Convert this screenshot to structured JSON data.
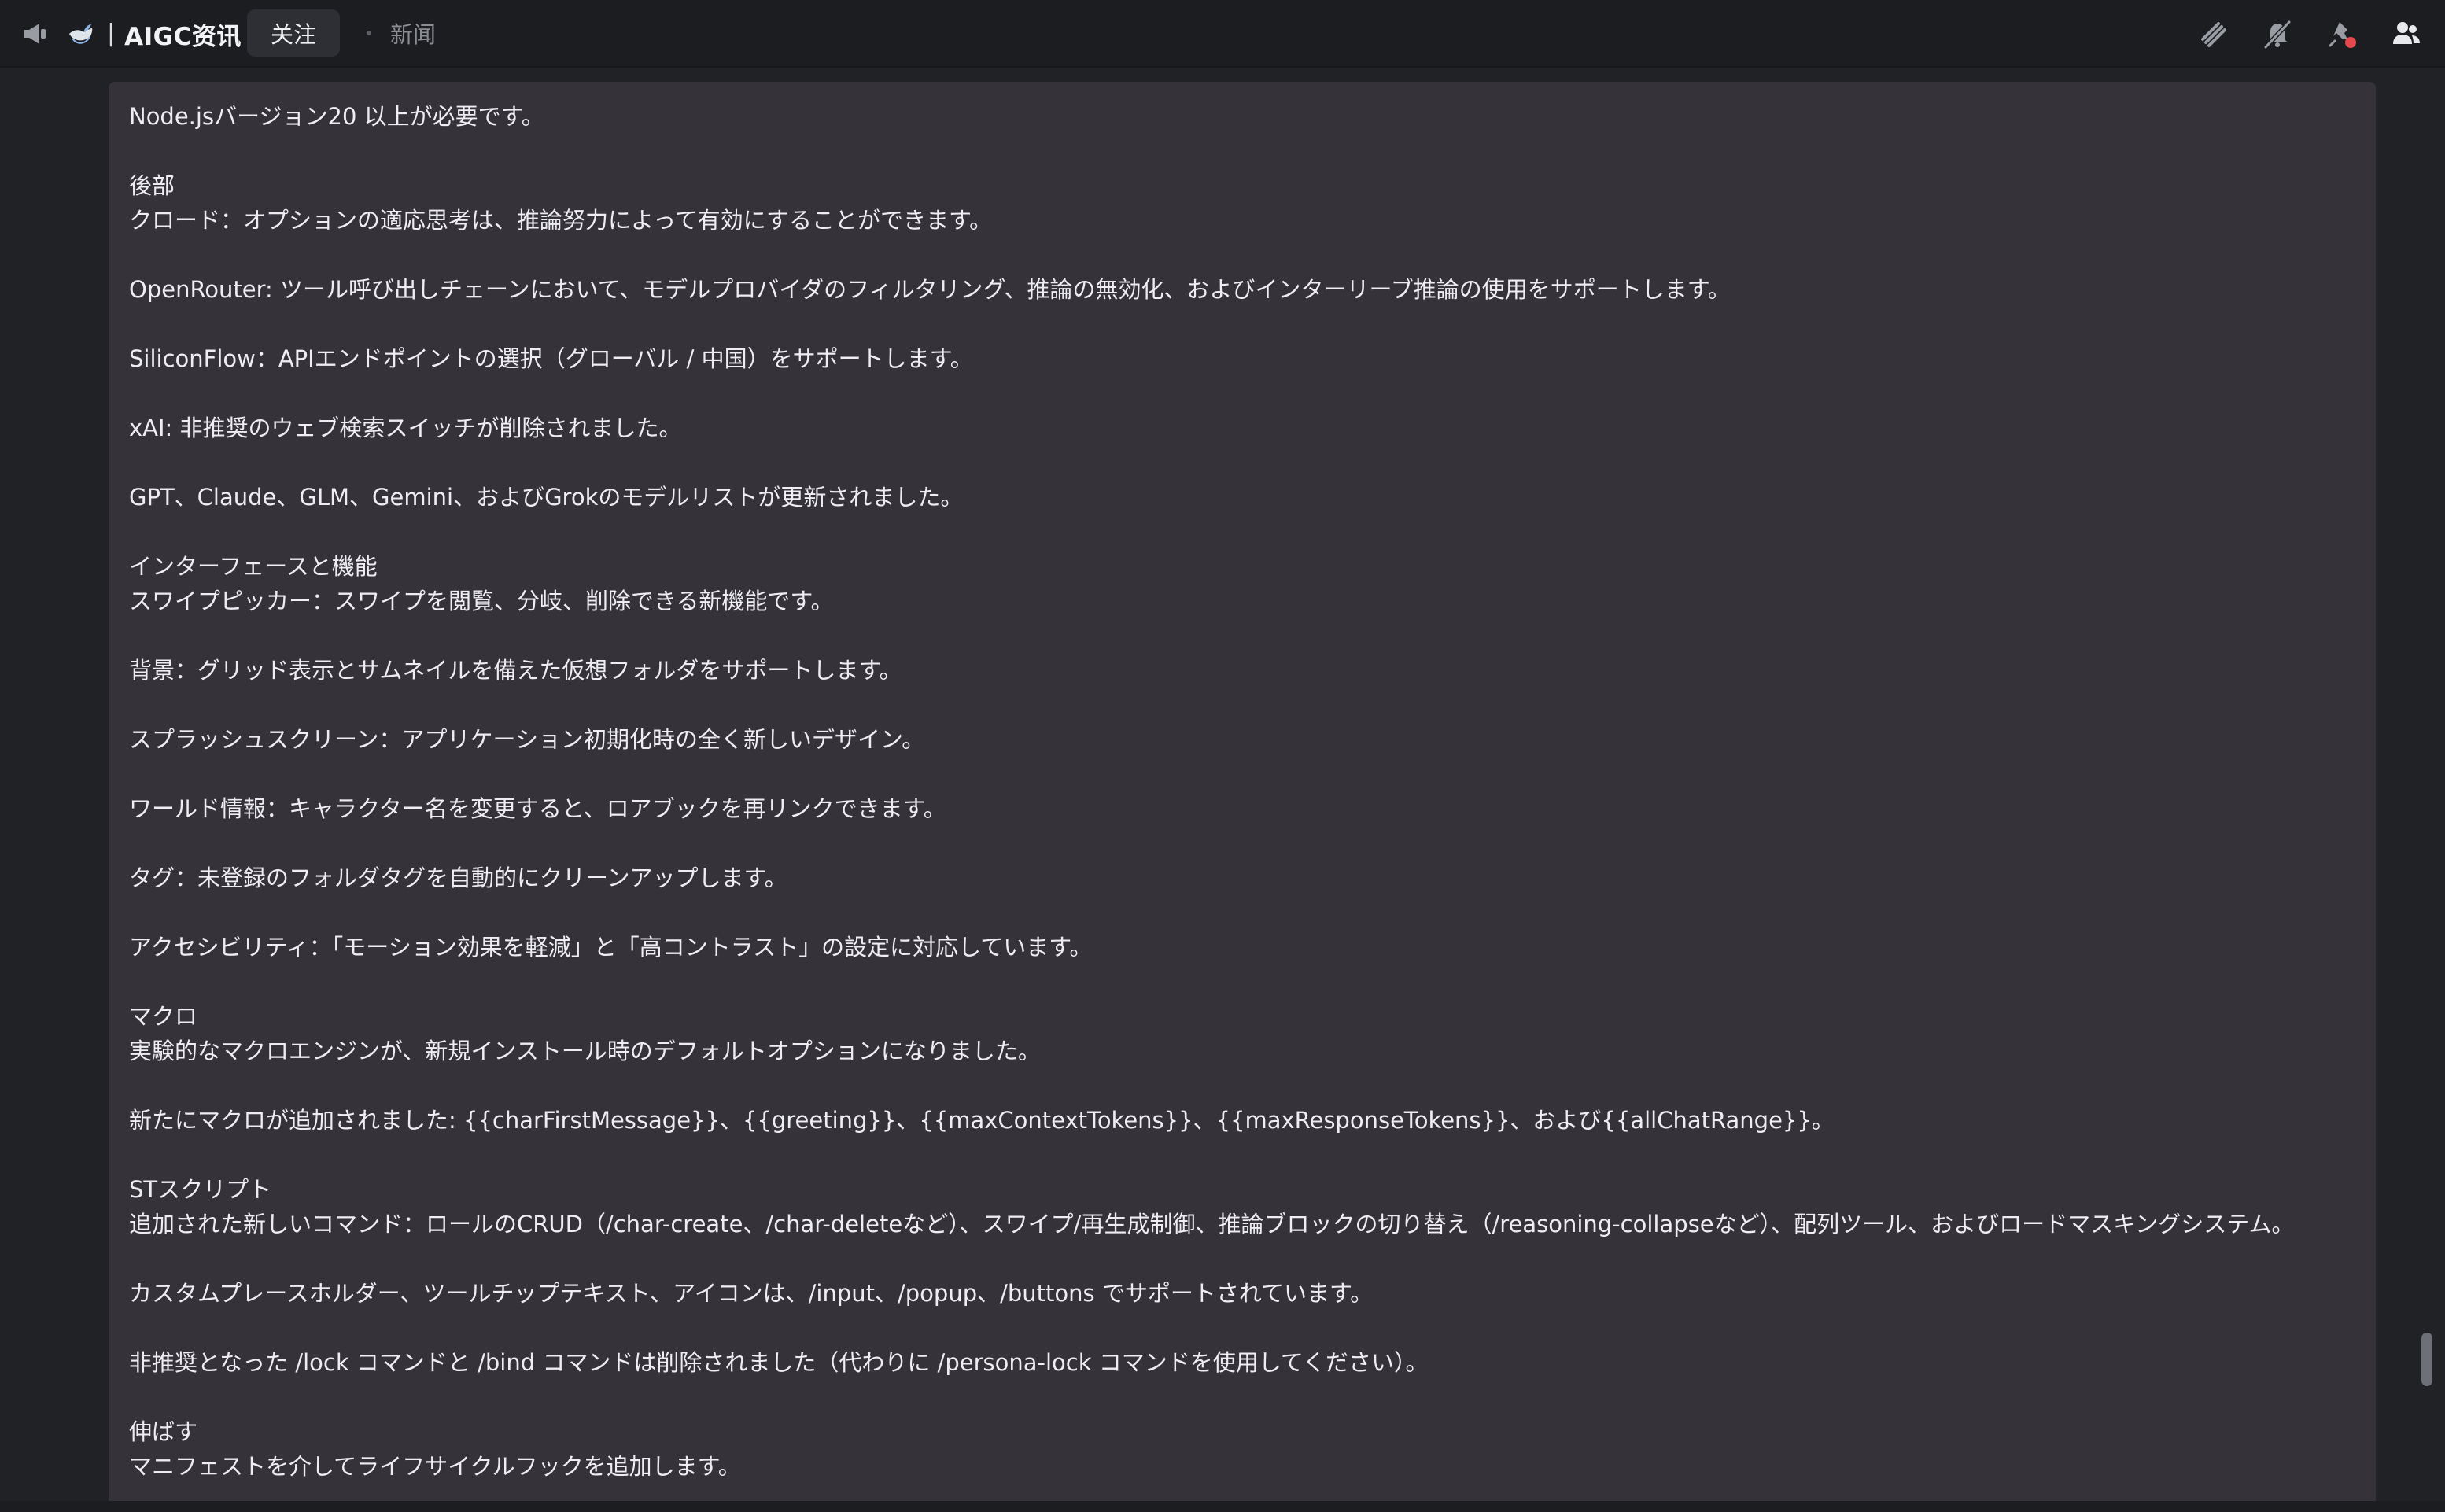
{
  "header": {
    "title": "AIGC资讯",
    "separator": "|",
    "tabs": [
      {
        "label": "关注",
        "active": true
      },
      {
        "label": "新闻",
        "active": false
      }
    ],
    "icons": {
      "channel": "megaphone-icon",
      "bird": "bird-icon",
      "threads": "threads-icon",
      "mute": "bell-muted-icon",
      "pin": "pin-icon",
      "members": "members-icon"
    }
  },
  "colors": {
    "topbar": "#1c1d21",
    "background": "#212226",
    "panel": "#35323a",
    "text": "#eeeef2",
    "muted": "#8b8d94",
    "notification_dot": "#e5484d"
  },
  "message": {
    "lines": [
      "Node.jsバージョン20 以上が必要です。",
      "",
      "後部",
      "クロード：オプションの適応思考は、推論努力によって有効にすることができます。",
      "",
      "OpenRouter: ツール呼び出しチェーンにおいて、モデルプロバイダのフィルタリング、推論の無効化、およびインターリーブ推論の使用をサポートします。",
      "",
      "SiliconFlow：APIエンドポイントの選択（グローバル / 中国）をサポートします。",
      "",
      "xAI: 非推奨のウェブ検索スイッチが削除されました。",
      "",
      "GPT、Claude、GLM、Gemini、およびGrokのモデルリストが更新されました。",
      "",
      "インターフェースと機能",
      "スワイプピッカー：スワイプを閲覧、分岐、削除できる新機能です。",
      "",
      "背景：グリッド表示とサムネイルを備えた仮想フォルダをサポートします。",
      "",
      "スプラッシュスクリーン：アプリケーション初期化時の全く新しいデザイン。",
      "",
      "ワールド情報：キャラクター名を変更すると、ロアブックを再リンクできます。",
      "",
      "タグ：未登録のフォルダタグを自動的にクリーンアップします。",
      "",
      "アクセシビリティ：「モーション効果を軽減」と「高コントラスト」の設定に対応しています。",
      "",
      "マクロ",
      "実験的なマクロエンジンが、新規インストール時のデフォルトオプションになりました。",
      "",
      "新たにマクロが追加されました: {{charFirstMessage}}、{{greeting}}、{{maxContextTokens}}、{{maxResponseTokens}}、および{{allChatRange}}。",
      "",
      "STスクリプト",
      "追加された新しいコマンド：ロールのCRUD（/char-create、/char-deleteなど）、スワイプ/再生成制御、推論ブロックの切り替え（/reasoning-collapseなど）、配列ツール、およびロードマスキングシステム。",
      "",
      "カスタムプレースホルダー、ツールチップテキスト、アイコンは、/input、/popup、/buttons でサポートされています。",
      "",
      "非推奨となった /lock コマンドと /bind コマンドは削除されました（代わりに /persona-lock コマンドを使用してください）。",
      "",
      "伸ばす",
      "マニフェストを介してライフサイクルフックを追加します。"
    ]
  }
}
